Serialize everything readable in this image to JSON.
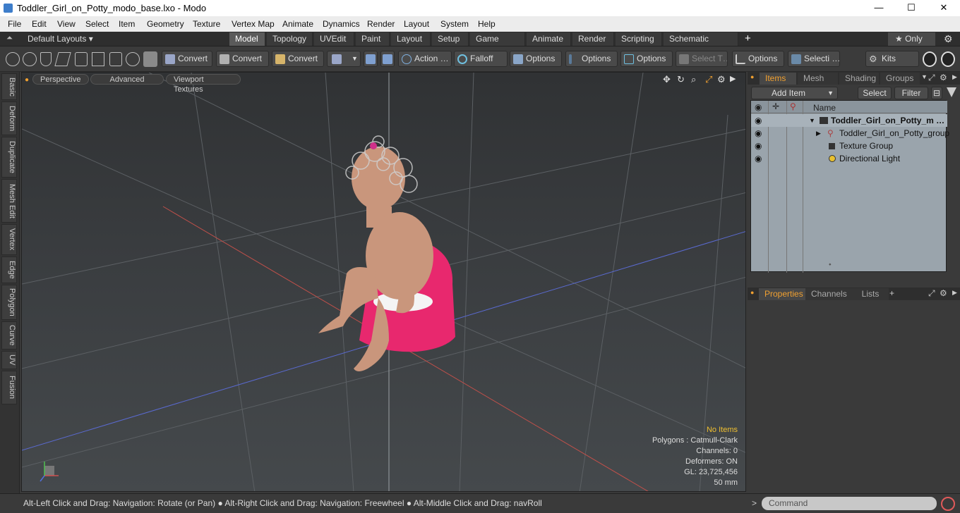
{
  "window": {
    "title": "Toddler_Girl_on_Potty_modo_base.lxo - Modo",
    "minimize": "—",
    "maximize": "☐",
    "close": "✕"
  },
  "menu": [
    "File",
    "Edit",
    "View",
    "Select",
    "Item",
    "Geometry",
    "Texture",
    "Vertex Map",
    "Animate",
    "Dynamics",
    "Render",
    "Layout",
    "System",
    "Help"
  ],
  "layoutbar": {
    "default_layouts": "Default Layouts ▾",
    "tabs": [
      "Model",
      "Topology",
      "UVEdit",
      "Paint",
      "Layout",
      "Setup",
      "Game Tools",
      "Animate",
      "Render",
      "Scripting",
      "Schematic Fusion"
    ],
    "active_tab": "Model",
    "add": "+",
    "only_label": "★  Only",
    "gear": "⚙"
  },
  "toolbar": {
    "buttons": [
      "Convert",
      "Convert",
      "Convert",
      "Action …",
      "Falloff",
      "Options",
      "Options",
      "Options",
      "Select T…",
      "Options",
      "Selecti …",
      "Kits"
    ]
  },
  "left_tabs": [
    "Basic",
    "Deform",
    "Duplicate",
    "Mesh Edit",
    "Vertex",
    "Edge",
    "Polygon",
    "Curve",
    "UV",
    "Fusion"
  ],
  "viewport": {
    "tabs": [
      "Perspective",
      "Advanced",
      "Viewport Textures"
    ],
    "stats": {
      "no_items": "No Items",
      "polygons": "Polygons : Catmull-Clark",
      "channels": "Channels: 0",
      "deformers": "Deformers: ON",
      "gl": "GL: 23,725,456",
      "scale": "50 mm"
    }
  },
  "items_panel": {
    "tabs": [
      "Items",
      "Mesh …",
      "Shading",
      "Groups"
    ],
    "add_item": "Add Item",
    "select": "Select",
    "filter": "Filter",
    "column_name": "Name",
    "items": [
      {
        "label": "Toddler_Girl_on_Potty_m …",
        "icon": "scene-icon"
      },
      {
        "label": "Toddler_Girl_on_Potty_group",
        "icon": "group-icon"
      },
      {
        "label": "Texture Group",
        "icon": "texture-icon"
      },
      {
        "label": "Directional Light",
        "icon": "light-icon"
      }
    ]
  },
  "properties_panel": {
    "tabs": [
      "Properties",
      "Channels",
      "Lists"
    ],
    "add": "+"
  },
  "statusbar": {
    "message": "Alt-Left Click and Drag: Navigation: Rotate (or Pan) ● Alt-Right Click and Drag: Navigation: Freewheel ● Alt-Middle Click and Drag: navRoll",
    "command_placeholder": "Command"
  },
  "colors": {
    "accent": "#f0a030",
    "potty": "#e8286e",
    "panel": "#3a3a3a",
    "list_bg": "#9aa4ac"
  }
}
